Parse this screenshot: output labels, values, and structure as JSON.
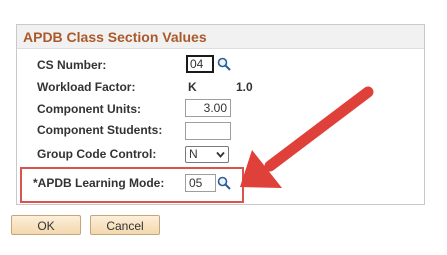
{
  "group": {
    "title": "APDB Class Section Values"
  },
  "fields": {
    "cs_number": {
      "label": "CS Number:",
      "value": "04"
    },
    "workload_factor": {
      "label": "Workload Factor:",
      "value": "K",
      "extra": "1.0"
    },
    "component_units": {
      "label": "Component Units:",
      "value": "3.00"
    },
    "component_students": {
      "label": "Component Students:",
      "value": ""
    },
    "group_code_control": {
      "label": "Group Code Control:",
      "value": "N"
    },
    "learning_mode": {
      "label": "*APDB Learning Mode:",
      "value": "05"
    }
  },
  "buttons": {
    "ok": "OK",
    "cancel": "Cancel"
  },
  "icons": {
    "lookup": "magnifier-icon",
    "dropdown": "chevron-down-icon",
    "annotation": "arrow-pointer"
  },
  "colors": {
    "title": "#aa5a2a",
    "highlight": "#d9534f",
    "arrow": "#e0403a",
    "button": "#f3d8ae"
  }
}
